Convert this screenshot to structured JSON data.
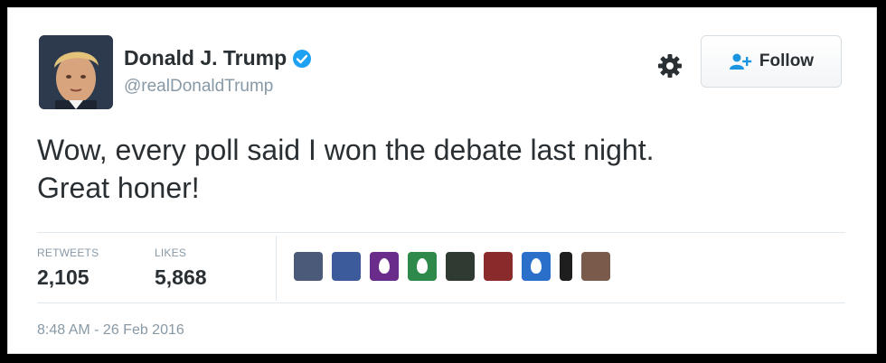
{
  "user": {
    "display_name": "Donald J. Trump",
    "handle": "@realDonaldTrump",
    "verified": true
  },
  "actions": {
    "follow_label": "Follow",
    "settings_icon": "gear-icon"
  },
  "tweet": {
    "text_line1": "Wow, every poll said I won the debate last night.",
    "text_line2": "Great honer!"
  },
  "stats": {
    "retweets_label": "RETWEETS",
    "retweets_value": "2,105",
    "likes_label": "LIKES",
    "likes_value": "5,868"
  },
  "likers": [
    {
      "kind": "photo",
      "color": "#4a5a78"
    },
    {
      "kind": "photo",
      "color": "#3b5b9a"
    },
    {
      "kind": "egg",
      "color": "#6a2c8a"
    },
    {
      "kind": "egg",
      "color": "#2e8a4a"
    },
    {
      "kind": "photo",
      "color": "#2f3a33"
    },
    {
      "kind": "photo",
      "color": "#8a2a2a"
    },
    {
      "kind": "egg",
      "color": "#2a6fc9"
    },
    {
      "kind": "photo",
      "color": "#1e1e1e"
    },
    {
      "kind": "photo",
      "color": "#7a5a4a"
    }
  ],
  "timestamp": "8:48 AM - 26 Feb 2016",
  "colors": {
    "text_primary": "#292f33",
    "text_secondary": "#8899a6",
    "verified_blue": "#1da1f2",
    "follow_icon_blue": "#1b95e0"
  }
}
